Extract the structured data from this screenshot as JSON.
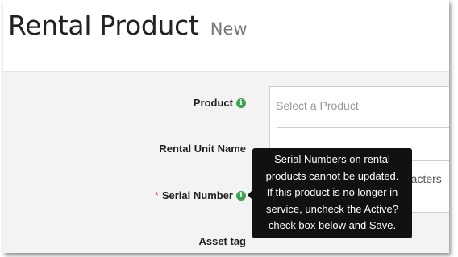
{
  "header": {
    "title": "Rental Product",
    "subtitle": "New"
  },
  "form": {
    "product": {
      "label": "Product",
      "placeholder": "Select a Product",
      "info_icon": "info-circle-icon"
    },
    "rental_unit_name": {
      "label": "Rental Unit Name",
      "hint_fragment": "racters"
    },
    "serial_number": {
      "required_mark": "*",
      "label": "Serial Number",
      "info_icon": "info-circle-icon"
    },
    "asset_tag": {
      "label": "Asset tag"
    }
  },
  "tooltip": {
    "lines": [
      "Serial Numbers on rental",
      "products cannot be updated.",
      "If this product is no longer in",
      "service, uncheck the Active?",
      "check box below and Save."
    ]
  },
  "colors": {
    "info_icon": "#3ea154",
    "required": "#d9534f",
    "tooltip_bg": "#111111",
    "form_bg": "#f3f3f3"
  }
}
